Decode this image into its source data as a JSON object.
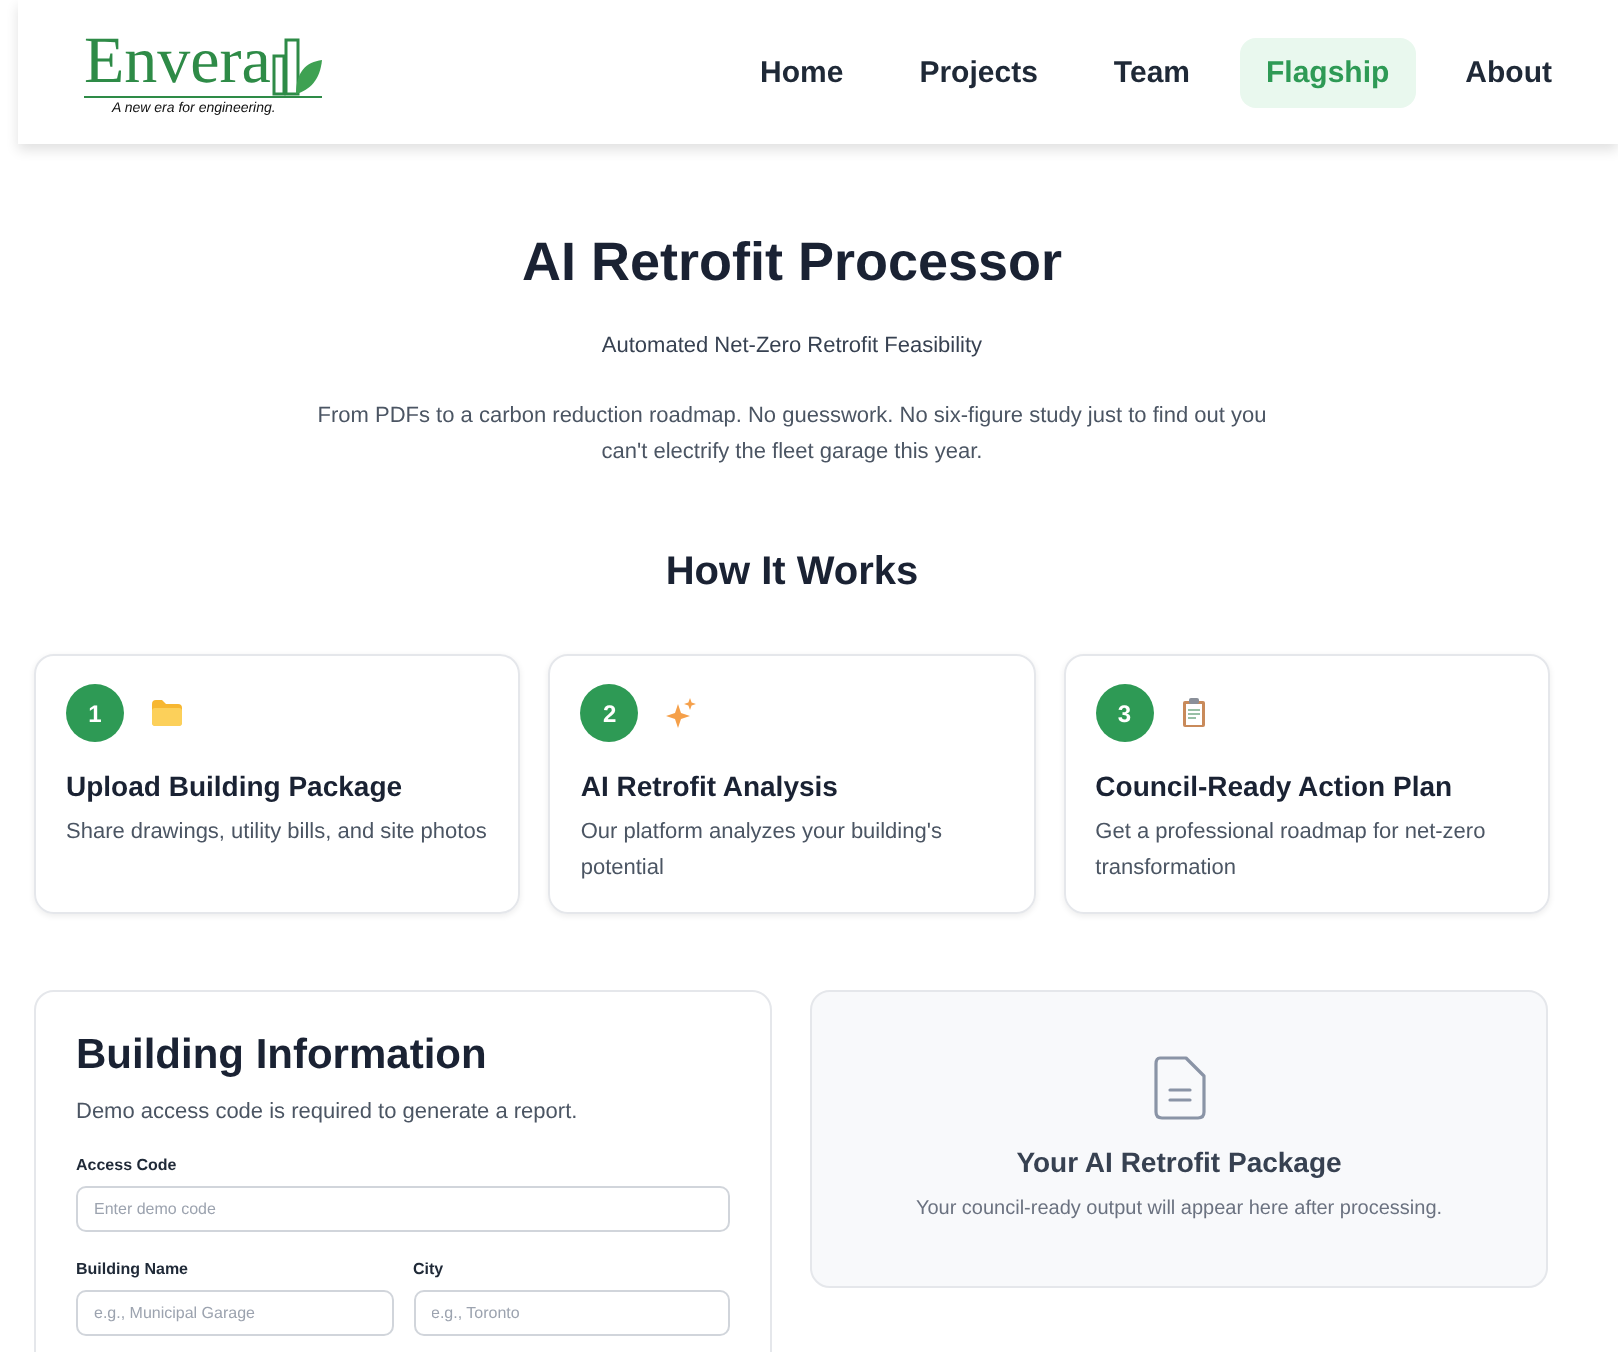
{
  "brand": {
    "name": "Envera",
    "tagline": "A new era for engineering."
  },
  "nav": [
    {
      "label": "Home",
      "selected": false
    },
    {
      "label": "Projects",
      "selected": false
    },
    {
      "label": "Team",
      "selected": false
    },
    {
      "label": "Flagship",
      "selected": true
    },
    {
      "label": "About",
      "selected": false
    }
  ],
  "hero": {
    "title": "AI Retrofit Processor",
    "subtitle": "Automated Net-Zero Retrofit Feasibility",
    "description": "From PDFs to a carbon reduction roadmap. No guesswork. No six-figure study just to find out you can't electrify the fleet garage this year."
  },
  "how_it_works": {
    "title": "How It Works",
    "steps": [
      {
        "number": "1",
        "kind": "folder",
        "title": "Upload Building Package",
        "text": "Share drawings, utility bills, and site photos"
      },
      {
        "number": "2",
        "kind": "sparkle",
        "title": "AI Retrofit Analysis",
        "text": "Our platform analyzes your building's potential"
      },
      {
        "number": "3",
        "kind": "clipboard",
        "title": "Council-Ready Action Plan",
        "text": "Get a professional roadmap for net-zero transformation"
      }
    ]
  },
  "form": {
    "title": "Building Information",
    "note": "Demo access code is required to generate a report.",
    "fields": [
      {
        "label": "Access Code",
        "placeholder": "Enter demo code",
        "kind": "full"
      },
      {
        "label": "Building Name",
        "placeholder": "e.g., Municipal Garage",
        "kind": "half"
      },
      {
        "label": "City",
        "placeholder": "e.g., Toronto",
        "kind": "half"
      }
    ]
  },
  "output": {
    "title": "Your AI Retrofit Package",
    "text": "Your council-ready output will appear here after processing."
  }
}
